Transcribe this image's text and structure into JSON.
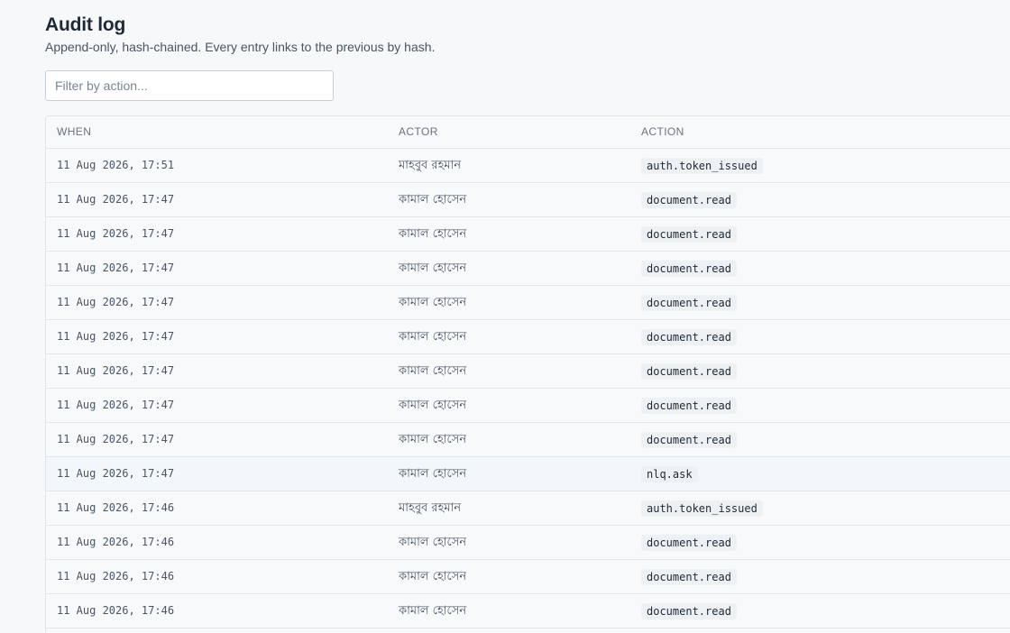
{
  "header": {
    "title": "Audit log",
    "subtitle": "Append-only, hash-chained. Every entry links to the previous by hash."
  },
  "filter": {
    "placeholder": "Filter by action..."
  },
  "table": {
    "columns": {
      "when": "WHEN",
      "actor": "ACTOR",
      "action": "ACTION"
    },
    "rows": [
      {
        "when": "11 Aug 2026, 17:51",
        "actor": "মাহবুব রহমান",
        "action": "auth.token_issued"
      },
      {
        "when": "11 Aug 2026, 17:47",
        "actor": "কামাল হোসেন",
        "action": "document.read"
      },
      {
        "when": "11 Aug 2026, 17:47",
        "actor": "কামাল হোসেন",
        "action": "document.read"
      },
      {
        "when": "11 Aug 2026, 17:47",
        "actor": "কামাল হোসেন",
        "action": "document.read"
      },
      {
        "when": "11 Aug 2026, 17:47",
        "actor": "কামাল হোসেন",
        "action": "document.read"
      },
      {
        "when": "11 Aug 2026, 17:47",
        "actor": "কামাল হোসেন",
        "action": "document.read"
      },
      {
        "when": "11 Aug 2026, 17:47",
        "actor": "কামাল হোসেন",
        "action": "document.read"
      },
      {
        "when": "11 Aug 2026, 17:47",
        "actor": "কামাল হোসেন",
        "action": "document.read"
      },
      {
        "when": "11 Aug 2026, 17:47",
        "actor": "কামাল হোসেন",
        "action": "document.read"
      },
      {
        "when": "11 Aug 2026, 17:47",
        "actor": "কামাল হোসেন",
        "action": "nlq.ask"
      },
      {
        "when": "11 Aug 2026, 17:46",
        "actor": "মাহবুব রহমান",
        "action": "auth.token_issued"
      },
      {
        "when": "11 Aug 2026, 17:46",
        "actor": "কামাল হোসেন",
        "action": "document.read"
      },
      {
        "when": "11 Aug 2026, 17:46",
        "actor": "কামাল হোসেন",
        "action": "document.read"
      },
      {
        "when": "11 Aug 2026, 17:46",
        "actor": "কামাল হোসেন",
        "action": "document.read"
      }
    ]
  }
}
